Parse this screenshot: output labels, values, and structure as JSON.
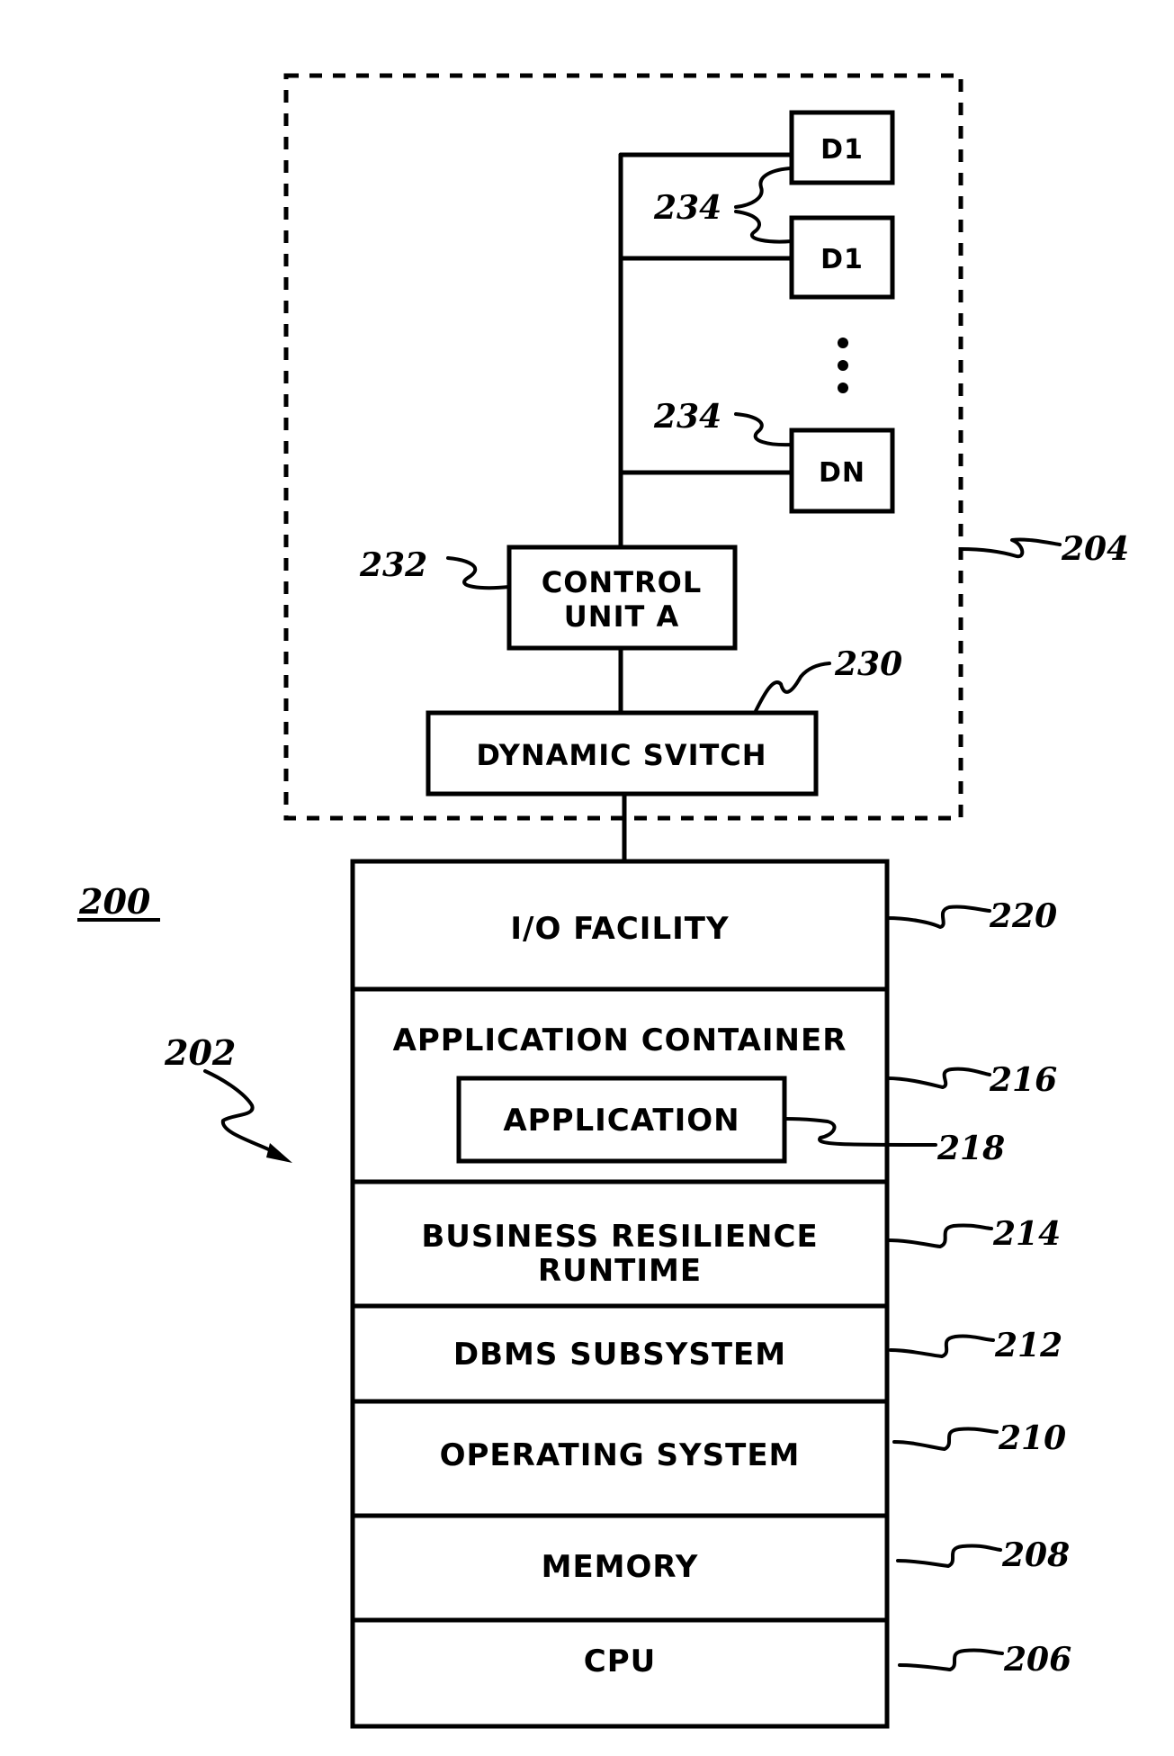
{
  "figure": {
    "number_label": "200",
    "system_label": "202"
  },
  "storage_subsystem": {
    "ref": "204",
    "dynamic_switch": {
      "label": "DYNAMIC SVITCH",
      "ref": "230"
    },
    "control_unit": {
      "line1": "CONTROL",
      "line2": "UNIT A",
      "ref": "232"
    },
    "devices": [
      {
        "label": "D1"
      },
      {
        "label": "D1"
      },
      {
        "label": "DN"
      }
    ],
    "device_ref": "234",
    "ellipsis": "⋮"
  },
  "stack": {
    "layers": [
      {
        "label": "I/O FACILITY",
        "ref": "220"
      },
      {
        "label": "APPLICATION CONTAINER",
        "ref": "216",
        "inner": {
          "label": "APPLICATION",
          "ref": "218"
        }
      },
      {
        "line1": "BUSINESS RESILIENCE",
        "line2": "RUNTIME",
        "ref": "214"
      },
      {
        "label": "DBMS SUBSYSTEM",
        "ref": "212"
      },
      {
        "label": "OPERATING SYSTEM",
        "ref": "210"
      },
      {
        "label": "MEMORY",
        "ref": "208"
      },
      {
        "label": "CPU",
        "ref": "206"
      }
    ]
  }
}
